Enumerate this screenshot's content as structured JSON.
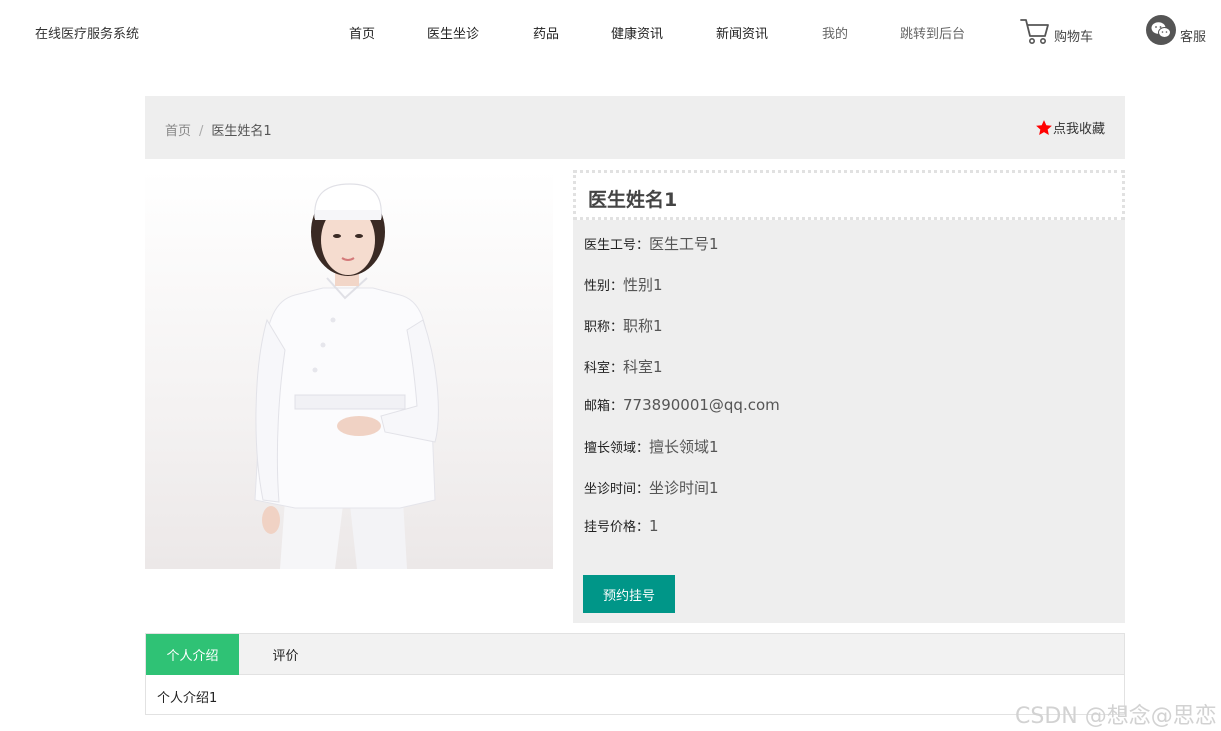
{
  "header": {
    "brand": "在线医疗服务系统",
    "nav": [
      {
        "label": "首页"
      },
      {
        "label": "医生坐诊"
      },
      {
        "label": "药品"
      },
      {
        "label": "健康资讯"
      },
      {
        "label": "新闻资讯"
      },
      {
        "label": "我的"
      },
      {
        "label": "跳转到后台"
      }
    ],
    "cart_label": "购物车",
    "service_label": "客服",
    "cart_icon": "shopping-cart-icon",
    "service_icon": "wechat-icon"
  },
  "breadcrumb": {
    "home": "首页",
    "separator": "/",
    "current": "医生姓名1"
  },
  "favorite": {
    "label": "点我收藏",
    "icon": "star-icon",
    "icon_color": "#ff0000"
  },
  "doctor": {
    "name": "医生姓名1",
    "fields": [
      {
        "label": "医生工号：",
        "value": "医生工号1"
      },
      {
        "label": "性别：",
        "value": "性别1"
      },
      {
        "label": "职称：",
        "value": "职称1"
      },
      {
        "label": "科室：",
        "value": "科室1"
      },
      {
        "label": "邮箱：",
        "value": "773890001@qq.com"
      },
      {
        "label": "擅长领域：",
        "value": "擅长领域1"
      },
      {
        "label": "坐诊时间：",
        "value": "坐诊时间1"
      },
      {
        "label": "挂号价格：",
        "value": "1"
      }
    ],
    "book_button": "预约挂号",
    "book_button_color": "#009688"
  },
  "tabs": {
    "items": [
      {
        "label": "个人介绍"
      },
      {
        "label": "评价"
      }
    ],
    "active_color": "#2fc275",
    "content": "个人介绍1"
  },
  "watermark": "CSDN @想念@思恋"
}
